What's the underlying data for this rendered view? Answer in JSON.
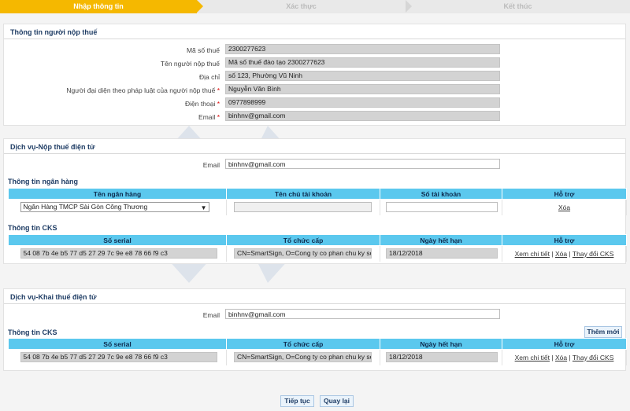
{
  "steps": [
    {
      "label": "Nhập thông tin",
      "active": true
    },
    {
      "label": "Xác thực",
      "active": false
    },
    {
      "label": "Kết thúc",
      "active": false
    }
  ],
  "taxpayer": {
    "title": "Thông tin người nộp thuế",
    "fields": [
      {
        "label": "Mã số thuế",
        "required": false,
        "value": "2300277623"
      },
      {
        "label": "Tên người nộp thuế",
        "required": false,
        "value": "Mã số thuế đào tạo 2300277623"
      },
      {
        "label": "Địa chỉ",
        "required": false,
        "value": "số 123, Phường Vũ Ninh"
      },
      {
        "label": "Người đại diện theo pháp luật của người nộp thuế",
        "required": true,
        "value": "Nguyễn Văn Bình"
      },
      {
        "label": "Điện thoại",
        "required": true,
        "value": "0977898999"
      },
      {
        "label": "Email",
        "required": true,
        "value": "binhnv@gmail.com"
      }
    ]
  },
  "payment_service": {
    "title": "Dịch vụ-Nộp thuế điện tử",
    "email_label": "Email",
    "email_value": "binhnv@gmail.com",
    "bank": {
      "title": "Thông tin ngân hàng",
      "headers": [
        "Tên ngân hàng",
        "Tên chủ tài khoản",
        "Số tài khoản",
        "Hỗ trợ"
      ],
      "selected_bank": "Ngân Hàng TMCP Sài Gòn Công Thương",
      "account_holder": "",
      "account_number": "",
      "action": "Xóa"
    },
    "cks": {
      "title": "Thông tin CKS",
      "headers": [
        "Số serial",
        "Tổ chức cấp",
        "Ngày hết hạn",
        "Hỗ trợ"
      ],
      "serial": "54 08 7b 4e b5 77 d5 27 29 7c 9e e8 78 66 f9 c3",
      "issuer": "CN=SmartSign, O=Cong ty co phan chu ky so Vi",
      "expiry": "18/12/2018",
      "actions": [
        "Xem chi tiết",
        "Xóa",
        "Thay đổi CKS"
      ]
    }
  },
  "declaration_service": {
    "title": "Dịch vụ-Khai thuế điện tử",
    "email_label": "Email",
    "email_value": "binhnv@gmail.com",
    "cks": {
      "title": "Thông tin CKS",
      "add_button": "Thêm mới",
      "headers": [
        "Số serial",
        "Tổ chức cấp",
        "Ngày hết hạn",
        "Hỗ trợ"
      ],
      "serial": "54 08 7b 4e b5 77 d5 27 29 7c 9e e8 78 66 f9 c3",
      "issuer": "CN=SmartSign, O=Cong ty co phan chu ky so Vi",
      "expiry": "18/12/2018",
      "actions": [
        "Xem chi tiết",
        "Xóa",
        "Thay đổi CKS"
      ]
    }
  },
  "footer": {
    "continue": "Tiếp tục",
    "back": "Quay lại"
  },
  "colors": {
    "active_step": "#f5b800",
    "table_header": "#5bc8ee",
    "title_text": "#1e3c64"
  }
}
